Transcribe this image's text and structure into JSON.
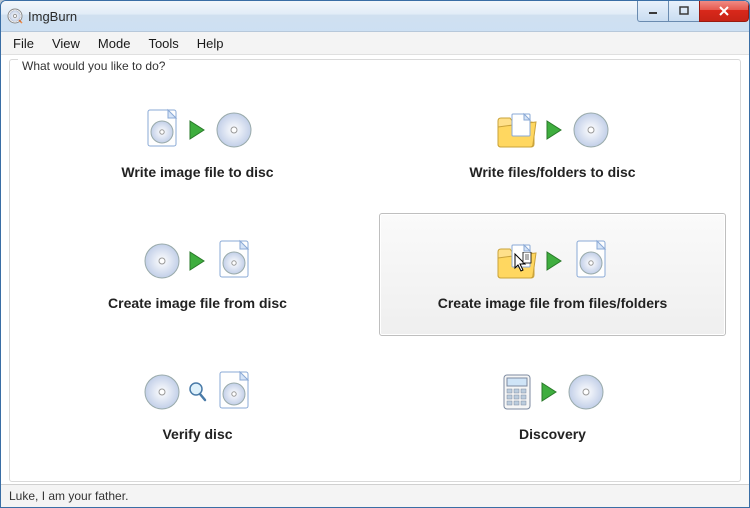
{
  "window": {
    "title": "ImgBurn"
  },
  "menu": {
    "file": "File",
    "view": "View",
    "mode": "Mode",
    "tools": "Tools",
    "help": "Help"
  },
  "group": {
    "legend": "What would you like to do?"
  },
  "options": {
    "writeImage": {
      "label": "Write image file to disc"
    },
    "writeFiles": {
      "label": "Write files/folders to disc"
    },
    "createFromDisc": {
      "label": "Create image file from disc"
    },
    "createFromFiles": {
      "label": "Create image file from files/folders"
    },
    "verify": {
      "label": "Verify disc"
    },
    "discovery": {
      "label": "Discovery"
    }
  },
  "status": {
    "text": "Luke, I am your father."
  }
}
